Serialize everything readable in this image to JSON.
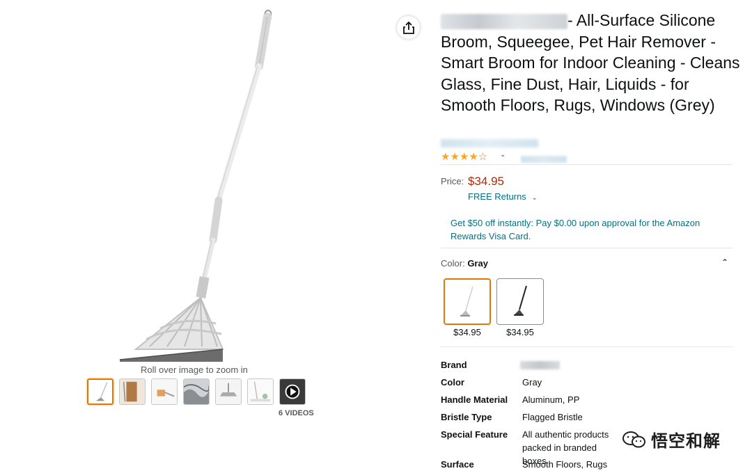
{
  "gallery": {
    "zoom_hint": "Roll over image to zoom in",
    "videos_label": "6 VIDEOS",
    "thumbnail_count": 7
  },
  "product": {
    "title": "- All-Surface Silicone Broom, Squeegee, Pet Hair Remover - Smart Broom for Indoor Cleaning - Cleans Glass, Fine Dust, Hair, Liquids - for Smooth Floors, Rugs, Windows (Grey)",
    "rating_stars": 4,
    "rating_max": 5
  },
  "price": {
    "label": "Price:",
    "value": "$34.95",
    "free_returns": "FREE Returns",
    "card_offer": "Get $50 off instantly: Pay $0.00 upon approval for the Amazon Rewards Visa Card."
  },
  "color": {
    "label": "Color:",
    "selected": "Gray",
    "swatches": [
      {
        "name": "Gray",
        "price": "$34.95"
      },
      {
        "name": "Black",
        "price": "$34.95"
      }
    ]
  },
  "specs": {
    "brand_key": "Brand",
    "color_key": "Color",
    "color_val": "Gray",
    "handle_key": "Handle Material",
    "handle_val": "Aluminum, PP",
    "bristle_key": "Bristle Type",
    "bristle_val": "Flagged Bristle",
    "feature_key": "Special Feature",
    "feature_val": "All authentic products packed in branded boxes",
    "surface_key": "Surface",
    "surface_val": "Smooth Floors, Rugs"
  },
  "watermark": {
    "text": "悟空和解"
  },
  "colors": {
    "price": "#b12704",
    "link": "#007185",
    "star": "#ffa41c",
    "selected_border": "#e77600"
  }
}
